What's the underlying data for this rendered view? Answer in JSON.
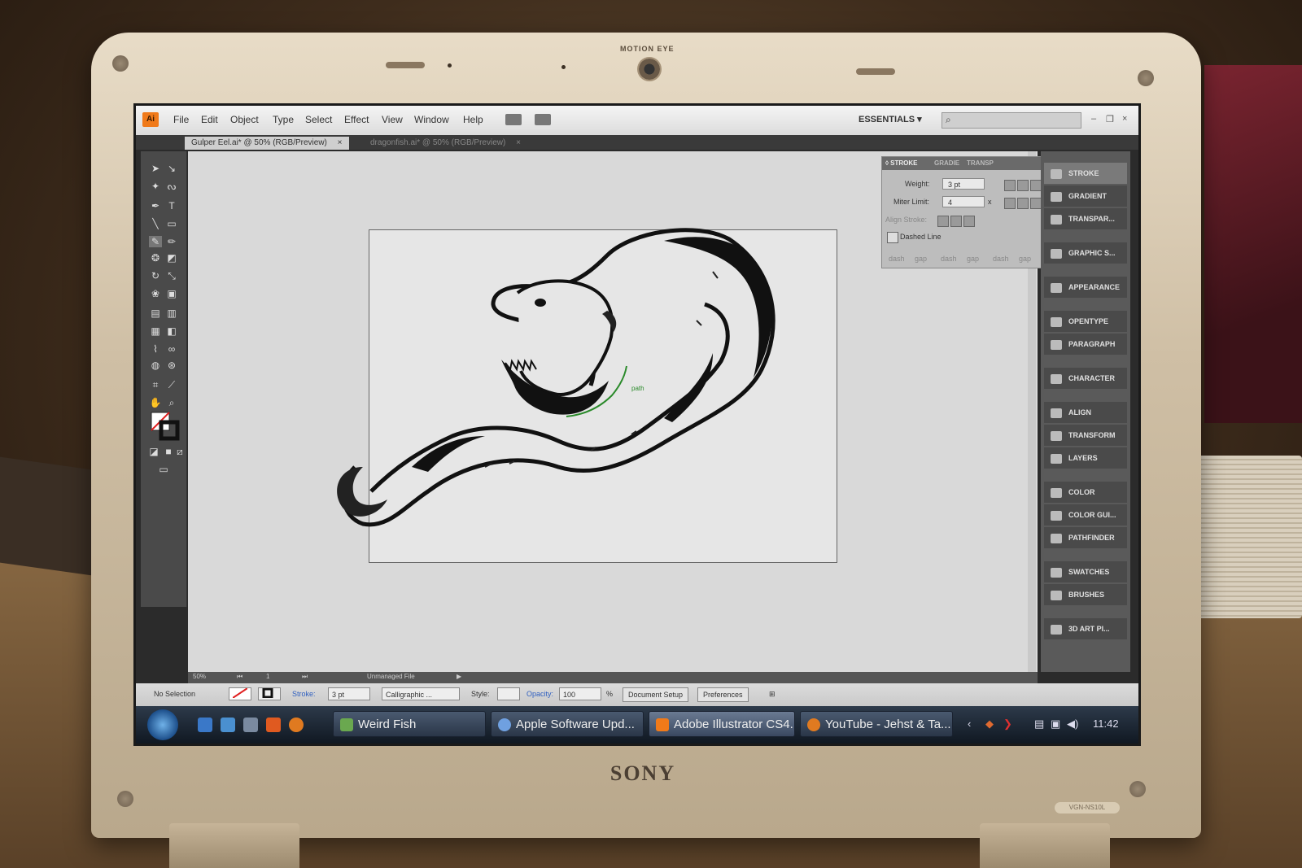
{
  "device": {
    "camera_label": "MOTION EYE",
    "brand": "SONY",
    "model": "VGN-NS10L"
  },
  "app": {
    "logo": "Ai",
    "workspace": "ESSENTIALS ▾"
  },
  "menu": [
    "File",
    "Edit",
    "Object",
    "Type",
    "Select",
    "Effect",
    "View",
    "Window",
    "Help"
  ],
  "tabs": [
    {
      "label": "Gulper Eel.ai* @ 50% (RGB/Preview)",
      "close": "×"
    },
    {
      "label": "dragonfish.ai* @ 50% (RGB/Preview)",
      "close": "×"
    }
  ],
  "stroke_panel": {
    "tabs": [
      "◊ STROKE",
      "GRADIE",
      "TRANSP"
    ],
    "weight_label": "Weight:",
    "weight_value": "3 pt",
    "miter_label": "Miter Limit:",
    "miter_value": "4",
    "miter_unit": "x",
    "align_label": "Align Stroke:",
    "dashed_label": "Dashed Line",
    "dash_fields": [
      "dash",
      "gap",
      "dash",
      "gap",
      "dash",
      "gap"
    ]
  },
  "dock": [
    "STROKE",
    "GRADIENT",
    "TRANSPAR...",
    "GRAPHIC S...",
    "APPEARANCE",
    "OPENTYPE",
    "PARAGRAPH",
    "CHARACTER",
    "ALIGN",
    "TRANSFORM",
    "LAYERS",
    "COLOR",
    "COLOR GUI...",
    "PATHFINDER",
    "SWATCHES",
    "BRUSHES",
    "3D ART PI..."
  ],
  "artwork": {
    "path_label": "path"
  },
  "status": {
    "zoom": "50%",
    "page": "1",
    "file_status": "Unmanaged File"
  },
  "control_bar": {
    "selection": "No Selection",
    "stroke_label": "Stroke:",
    "stroke_value": "3 pt",
    "brush": "Calligraphic ...",
    "style_label": "Style:",
    "opacity_label": "Opacity:",
    "opacity_value": "100",
    "opacity_unit": "%",
    "document_setup": "Document Setup",
    "preferences": "Preferences"
  },
  "taskbar": {
    "items": [
      "Weird Fish",
      "Apple Software Upd...",
      "Adobe Illustrator CS4...",
      "YouTube - Jehst & Ta..."
    ],
    "clock": "11:42"
  },
  "colors": {
    "accent": "#f07a1a",
    "canvas": "#d9d9d9",
    "artboard": "#e6e6e6",
    "taskbar": "#1c2634"
  }
}
